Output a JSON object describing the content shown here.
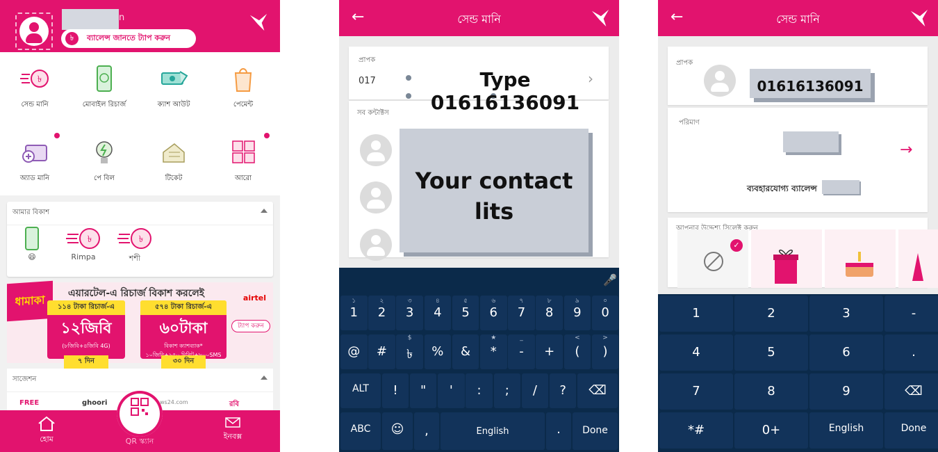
{
  "panel1": {
    "name_suffix": "n",
    "balance_badge": "৳",
    "balance_prompt": "ব্যালেন্স জানতে ট্যাপ করুন",
    "menu": [
      {
        "label": "সেন্ড মানি",
        "icon": "send-money-icon"
      },
      {
        "label": "মোবাইল রিচার্জ",
        "icon": "mobile-recharge-icon"
      },
      {
        "label": "ক্যাশ আউট",
        "icon": "cash-out-icon"
      },
      {
        "label": "পেমেন্ট",
        "icon": "payment-bag-icon"
      },
      {
        "label": "অ্যাড মানি",
        "icon": "add-money-icon"
      },
      {
        "label": "পে বিল",
        "icon": "pay-bill-icon"
      },
      {
        "label": "টিকেট",
        "icon": "ticket-icon"
      },
      {
        "label": "আরো",
        "icon": "more-grid-icon"
      }
    ],
    "my_bkash_title": "আমার বিকাশ",
    "favorites": [
      "😄",
      "Rimpa",
      "শশী"
    ],
    "banner": {
      "tag": "ধামাকা",
      "title": "এয়ারটেল-এ রিচার্জ বিকাশ করলেই",
      "offer1_head": "১১৪ টাকা রিচার্জ-এ",
      "offer1_big": "১২জিবি",
      "offer1_small": "(৮জিবি+৪জিবি 4G)",
      "offer1_days": "৭ দিন",
      "offer2_head": "৫৭৪ টাকা রিচার্জ-এ",
      "offer2_big": "৬০টাকা",
      "offer2_small": "বিকাশ ক্যাশব্যাক*",
      "offer2_small2": "১০জিবি+৯৫০ মিনিট+৮০০SMS",
      "offer2_days": "৩০ দিন",
      "brand": "airtel",
      "tap": "ট্যাপ করুন"
    },
    "suggestion_title": "সাজেশন",
    "suggestions": [
      "FREE",
      "ghoori",
      "ws24.com",
      "রবি"
    ],
    "nav": {
      "home": "হোম",
      "qr": "QR স্ক্যান",
      "inbox": "ইনবক্স"
    }
  },
  "panel2": {
    "title": "সেন্ড মানি",
    "recipient_label": "প্রাপক",
    "recipient_value": "017",
    "overlay_type": "Type 01616136091",
    "contacts_label": "সব কন্টাক্টস",
    "overlay_contacts": "Your contact lits",
    "keyboard": {
      "row1": [
        {
          "k": "1",
          "s": "১"
        },
        {
          "k": "2",
          "s": "২"
        },
        {
          "k": "3",
          "s": "৩"
        },
        {
          "k": "4",
          "s": "৪"
        },
        {
          "k": "5",
          "s": "৫"
        },
        {
          "k": "6",
          "s": "৬"
        },
        {
          "k": "7",
          "s": "৭"
        },
        {
          "k": "8",
          "s": "৮"
        },
        {
          "k": "9",
          "s": "৯"
        },
        {
          "k": "0",
          "s": "০"
        }
      ],
      "row2": [
        {
          "k": "@",
          "s": ""
        },
        {
          "k": "#",
          "s": ""
        },
        {
          "k": "৳",
          "s": "$"
        },
        {
          "k": "%",
          "s": ""
        },
        {
          "k": "&",
          "s": ""
        },
        {
          "k": "*",
          "s": "★"
        },
        {
          "k": "-",
          "s": "_"
        },
        {
          "k": "+",
          "s": ""
        },
        {
          "k": "(",
          "s": "<"
        },
        {
          "k": ")",
          "s": ">"
        }
      ],
      "row3": [
        "ALT",
        "!",
        "\"",
        "'",
        ":",
        ";",
        "/",
        "?"
      ],
      "row4": {
        "abc": "ABC",
        "lang": "English",
        "comma": ",",
        "dot": ".",
        "done": "Done"
      }
    }
  },
  "panel3": {
    "title": "সেন্ড মানি",
    "recipient_label": "প্রাপক",
    "recipient_number": "01616136091",
    "amount_label": "পরিমাণ",
    "usable_balance": "ব্যবহারযোগ্য ব্যালেন্স",
    "purpose_label": "আপনার উদ্দেশ্য সিলেক্ট করুন",
    "numpad": [
      [
        "1",
        "2",
        "3",
        "-"
      ],
      [
        "4",
        "5",
        "6",
        "."
      ],
      [
        "7",
        "8",
        "9",
        "⌫"
      ],
      [
        "*#",
        "0+",
        "English",
        "Done"
      ]
    ]
  },
  "colors": {
    "brand": "#e2136e",
    "keyboard": "#0b2a4a"
  }
}
